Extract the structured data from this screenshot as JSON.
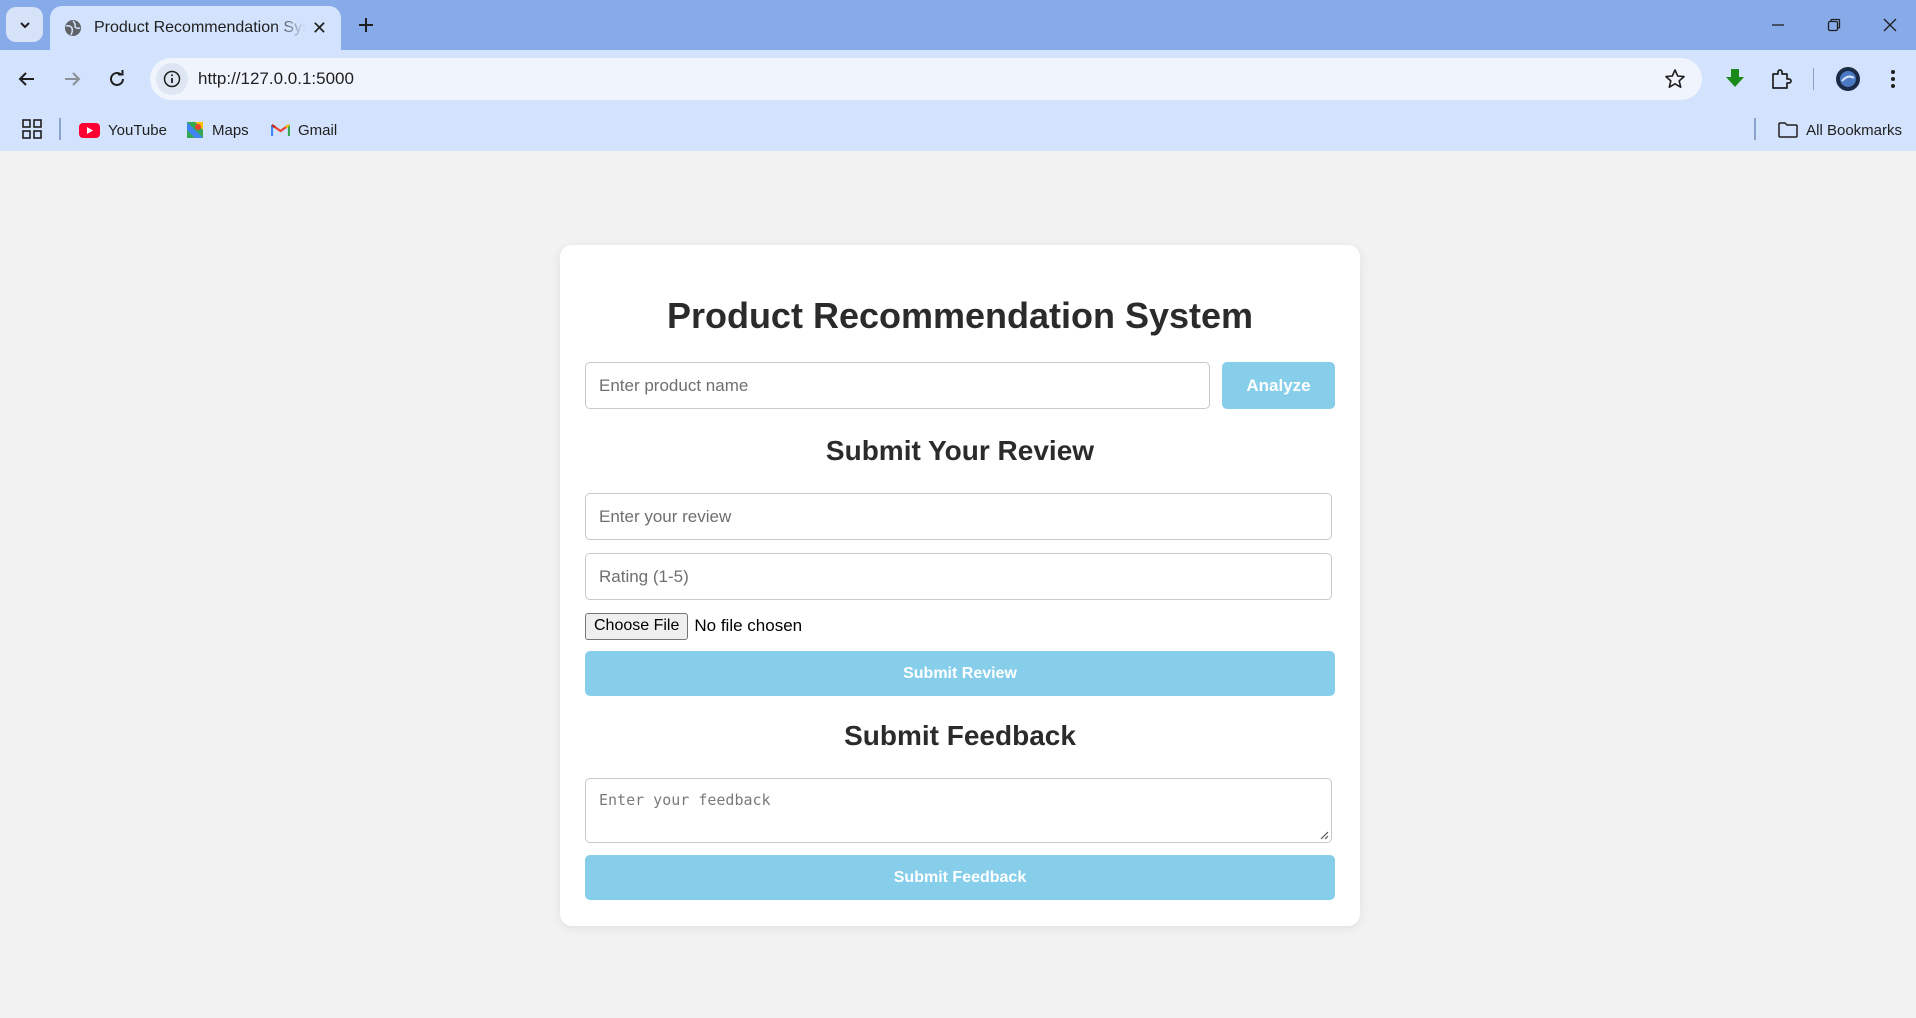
{
  "browser": {
    "tab_title": "Product Recommendation System",
    "url": "http://127.0.0.1:5000",
    "bookmarks": [
      {
        "label": "YouTube",
        "icon": "youtube-icon"
      },
      {
        "label": "Maps",
        "icon": "maps-icon"
      },
      {
        "label": "Gmail",
        "icon": "gmail-icon"
      }
    ],
    "all_bookmarks_label": "All Bookmarks"
  },
  "page": {
    "title": "Product Recommendation System",
    "product_input": {
      "placeholder": "Enter product name"
    },
    "analyze_label": "Analyze",
    "review_section": {
      "heading": "Submit Your Review",
      "review_placeholder": "Enter your review",
      "rating_placeholder": "Rating (1-5)",
      "file_button_label": "Choose File",
      "file_status": "No file chosen",
      "submit_label": "Submit Review"
    },
    "feedback_section": {
      "heading": "Submit Feedback",
      "feedback_placeholder": "Enter your feedback",
      "submit_label": "Submit Feedback"
    }
  },
  "colors": {
    "accent_button": "#87ceeb",
    "page_background": "#f2f2f2",
    "browser_frame": "#87abe8"
  }
}
